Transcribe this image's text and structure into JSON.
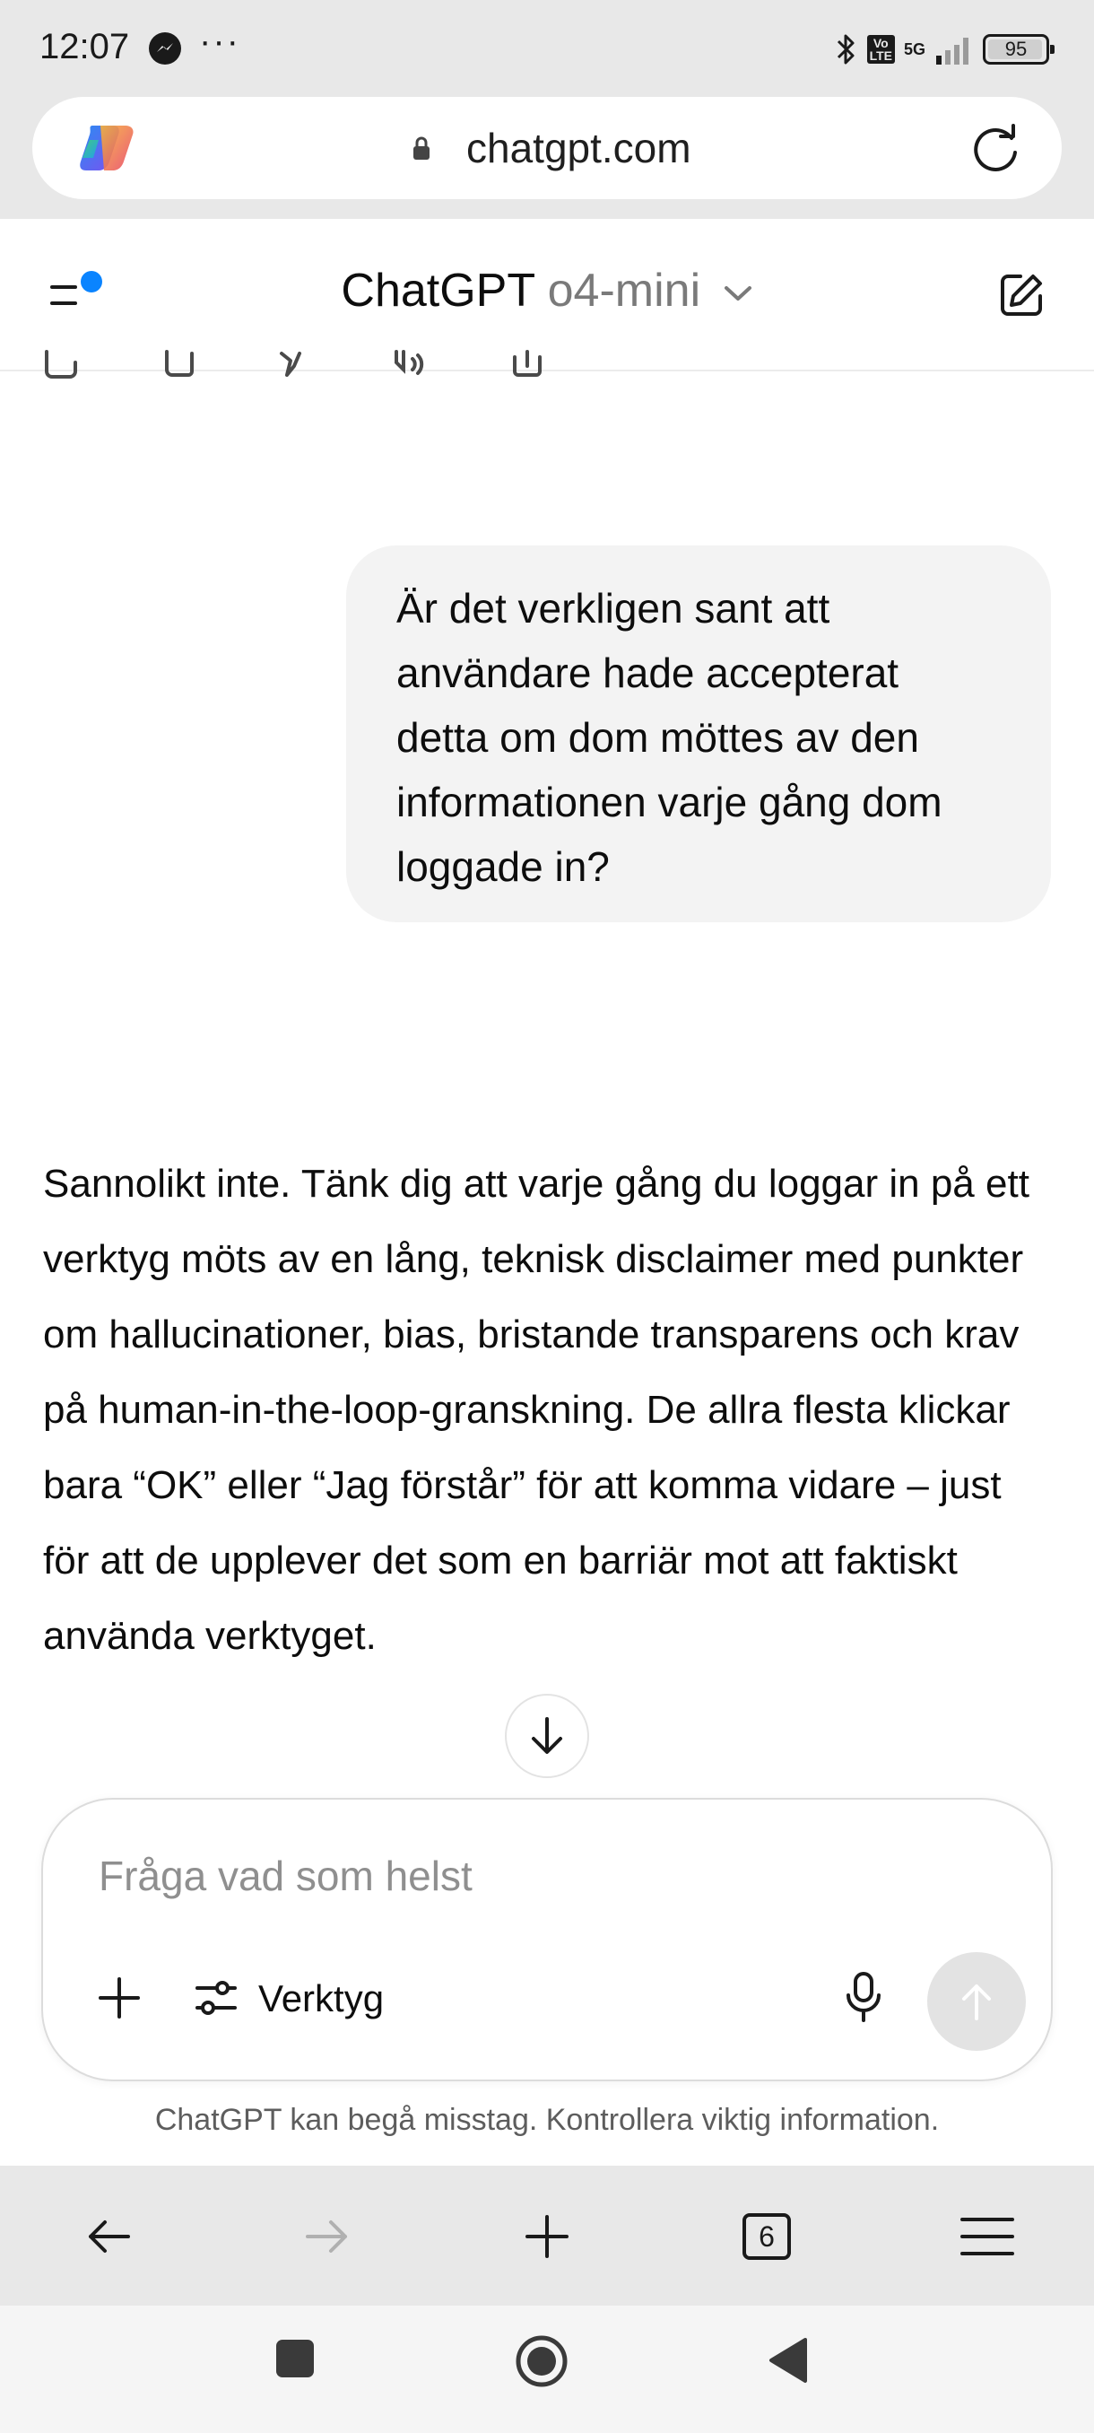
{
  "status_bar": {
    "time": "12:07",
    "more": "···",
    "network": "5G",
    "volte": "Vo\nLTE",
    "battery": "95"
  },
  "browser": {
    "url": "chatgpt.com",
    "tabs_count": "6"
  },
  "header": {
    "title": "ChatGPT",
    "model": "o4-mini"
  },
  "conversation": {
    "user_message": "Är det verkligen sant att användare hade accepterat detta om dom möttes av den informationen varje gång dom loggade in?",
    "assistant_message": "Sannolikt inte. Tänk dig att varje gång du loggar in på ett verktyg möts av en lång, teknisk disclaimer med punkter om hallucinationer, bias, bristande transparens och krav på human-in-the-loop-granskning. De allra flesta klickar bara “OK” eller “Jag förstår” för att komma vidare – just för att de upplever det som en barriär mot att faktiskt använda verktyget."
  },
  "composer": {
    "placeholder": "Fråga vad som helst",
    "tools_label": "Verktyg"
  },
  "disclaimer": "ChatGPT kan begå misstag. Kontrollera viktig information.",
  "colors": {
    "accent_dot": "#0a84ff",
    "chrome_bg": "#e8e8e8",
    "bubble_bg": "#f3f3f3"
  }
}
